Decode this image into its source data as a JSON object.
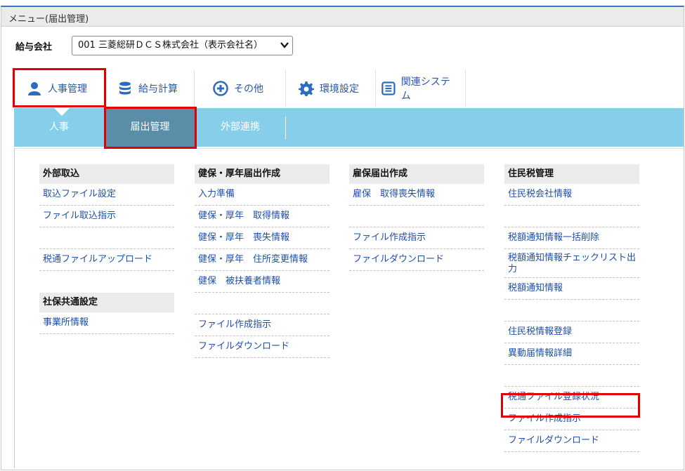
{
  "window": {
    "title": "メニュー(届出管理)"
  },
  "company": {
    "label": "給与会社",
    "selected": "001 三菱総研ＤＣＳ株式会社（表示会社名）"
  },
  "tabs": [
    {
      "label": "人事管理",
      "icon": "person-icon"
    },
    {
      "label": "給与計算",
      "icon": "database-icon"
    },
    {
      "label": "その他",
      "icon": "plus-circle-icon"
    },
    {
      "label": "環境設定",
      "icon": "gear-icon"
    },
    {
      "label": "関連システム",
      "icon": "list-icon"
    }
  ],
  "subnav": [
    "人事",
    "届出管理",
    "外部連携"
  ],
  "columns": {
    "c1": {
      "header": "外部取込",
      "items": [
        "取込ファイル設定",
        "ファイル取込指示",
        "",
        "税通ファイルアップロード"
      ],
      "header2": "社保共通設定",
      "items2": [
        "事業所情報"
      ]
    },
    "c2": {
      "header": "健保・厚年届出作成",
      "items": [
        "入力準備",
        "健保・厚年　取得情報",
        "健保・厚年　喪失情報",
        "健保・厚年　住所変更情報",
        "健保　被扶養者情報",
        "",
        "ファイル作成指示",
        "ファイルダウンロード"
      ]
    },
    "c3": {
      "header": "雇保届出作成",
      "items": [
        "雇保　取得喪失情報",
        "",
        "ファイル作成指示",
        "ファイルダウンロード"
      ]
    },
    "c4": {
      "header": "住民税管理",
      "items": [
        "住民税会社情報",
        "",
        "税額通知情報一括削除",
        "税額通知情報チェックリスト出力",
        "税額通知情報",
        "",
        "住民税情報登録",
        "異動届情報詳細",
        "",
        "税通ファイル登録状況",
        "ファイル作成指示",
        "ファイルダウンロード"
      ]
    }
  }
}
